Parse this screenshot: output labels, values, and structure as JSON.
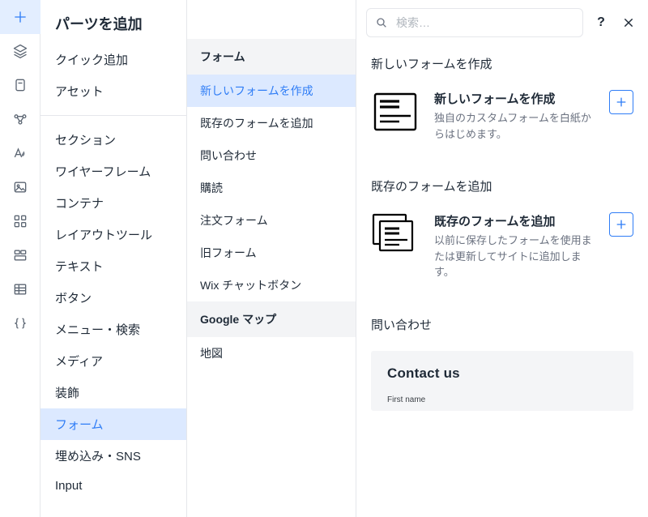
{
  "panel": {
    "title": "パーツを追加"
  },
  "search": {
    "placeholder": "検索…"
  },
  "col1": {
    "items": [
      "クイック追加",
      "アセット",
      "セクション",
      "ワイヤーフレーム",
      "コンテナ",
      "レイアウトツール",
      "テキスト",
      "ボタン",
      "メニュー・検索",
      "メディア",
      "装飾",
      "フォーム",
      "埋め込み・SNS",
      "Input"
    ],
    "selected": "フォーム"
  },
  "col2": {
    "groups": [
      {
        "header": "フォーム",
        "items": [
          "新しいフォームを作成",
          "既存のフォームを追加",
          "問い合わせ",
          "購読",
          "注文フォーム",
          "旧フォーム",
          "Wix チャットボタン"
        ],
        "selected": "新しいフォームを作成"
      },
      {
        "header": "Google マップ",
        "items": [
          "地図"
        ]
      }
    ]
  },
  "right": {
    "sections": [
      {
        "title": "新しいフォームを作成",
        "card": {
          "title": "新しいフォームを作成",
          "desc": "独自のカスタムフォームを白紙からはじめます。"
        }
      },
      {
        "title": "既存のフォームを追加",
        "card": {
          "title": "既存のフォームを追加",
          "desc": "以前に保存したフォームを使用または更新してサイトに追加します。"
        }
      },
      {
        "title": "問い合わせ",
        "preview": {
          "heading": "Contact us",
          "field_label": "First name"
        }
      }
    ]
  }
}
